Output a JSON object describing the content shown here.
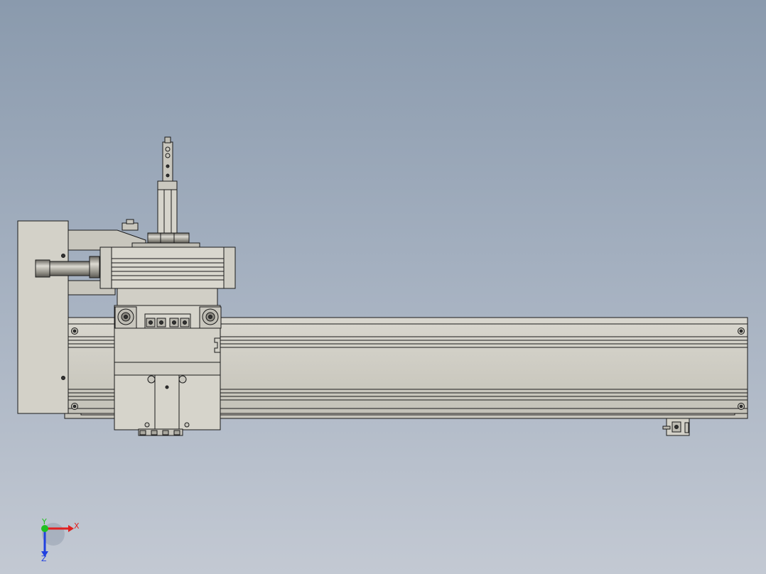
{
  "view": {
    "background_top": "#8a9aad",
    "background_bottom": "#c3c9d3",
    "part_color": "#cfcdc3",
    "edge_color": "#1a1a1a"
  },
  "triad": {
    "x_label": "X",
    "y_label": "Y",
    "z_label": "Z",
    "x_color": "#e02020",
    "y_color": "#20c020",
    "z_color": "#2040e0"
  }
}
